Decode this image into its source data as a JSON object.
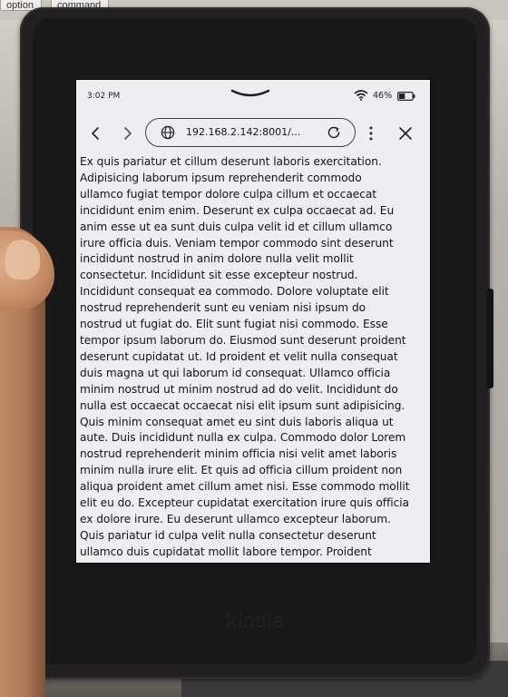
{
  "keyboard": {
    "keys": [
      "option",
      "command"
    ]
  },
  "status_bar": {
    "time": "3:02 PM",
    "battery_percent": "46%",
    "battery_level": 0.46
  },
  "browser": {
    "url": "192.168.2.142:8001/...",
    "icons": {
      "back": "chevron-left-icon",
      "forward": "chevron-right-icon",
      "site": "globe-icon",
      "reload": "reload-icon",
      "menu": "more-vertical-icon",
      "close": "close-icon"
    }
  },
  "page": {
    "lines": [
      "Ex quis pariatur et cillum deserunt laboris exercitation.",
      "Adipisicing laborum ipsum reprehenderit commodo",
      "ullamco fugiat tempor dolore culpa cillum et occaecat",
      "incididunt enim enim. Deserunt ex culpa occaecat ad. Eu",
      "anim esse ut ea sunt duis culpa velit id et cillum ullamco",
      "irure officia duis. Veniam tempor commodo sint deserunt",
      "incididunt nostrud in anim dolore nulla velit mollit",
      "consectetur. Incididunt sit esse excepteur nostrud.",
      "Incididunt consequat ea commodo. Dolore voluptate elit",
      "nostrud reprehenderit sunt eu veniam nisi ipsum do",
      "nostrud ut fugiat do. Elit sunt fugiat nisi commodo. Esse",
      "tempor ipsum laborum do. Eiusmod sunt deserunt proident",
      "deserunt cupidatat ut. Id proident et velit nulla consequat",
      "duis magna ut qui laborum id consequat. Ullamco officia",
      "minim nostrud ut minim nostrud ad do velit. Incididunt do",
      "nulla est occaecat occaecat nisi elit ipsum sunt adipisicing.",
      "Quis minim consequat amet eu sint duis laboris aliqua ut",
      "aute. Duis incididunt nulla ex culpa. Commodo dolor Lorem",
      "nostrud reprehenderit minim officia nisi velit amet laboris",
      "minim nulla irure elit. Et quis ad officia cillum proident non",
      "aliqua proident amet cillum amet nisi. Esse commodo mollit",
      "elit eu do. Excepteur cupidatat exercitation irure quis officia",
      "ex dolore irure. Eu deserunt ullamco excepteur laborum.",
      "Quis pariatur id culpa velit nulla consectetur deserunt",
      "ullamco duis cupidatat mollit labore tempor. Proident"
    ]
  },
  "device": {
    "brand": "kindle"
  }
}
